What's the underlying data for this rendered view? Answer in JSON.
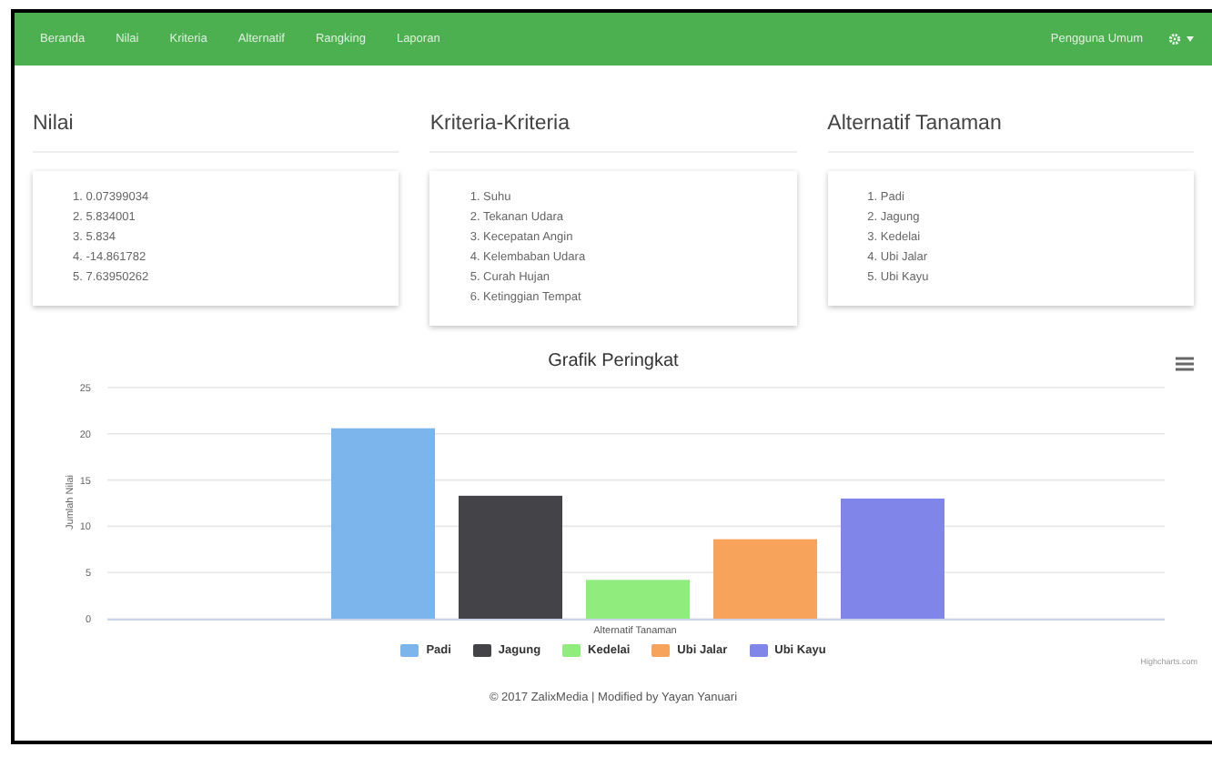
{
  "navbar": {
    "items": [
      "Beranda",
      "Nilai",
      "Kriteria",
      "Alternatif",
      "Rangking",
      "Laporan"
    ],
    "user": "Pengguna Umum"
  },
  "panels": [
    {
      "title": "Nilai",
      "items": [
        "1. 0.07399034",
        "2. 5.834001",
        "3. 5.834",
        "4. -14.861782",
        "5. 7.63950262"
      ]
    },
    {
      "title": "Kriteria-Kriteria",
      "items": [
        "1. Suhu",
        "2. Tekanan Udara",
        "3. Kecepatan Angin",
        "4. Kelembaban Udara",
        "5. Curah Hujan",
        "6. Ketinggian Tempat"
      ]
    },
    {
      "title": "Alternatif Tanaman",
      "items": [
        "1. Padi",
        "2. Jagung",
        "3. Kedelai",
        "4. Ubi Jalar",
        "5. Ubi Kayu"
      ]
    }
  ],
  "chart": {
    "credit": "Highcharts.com",
    "chart_data": {
      "type": "bar",
      "grid": true,
      "title": "Grafik Peringkat",
      "xlabel": "Alternatif Tanaman",
      "ylabel": "Jumlah Nilai",
      "ylim": [
        0,
        25
      ],
      "yticks": [
        0,
        5,
        10,
        15,
        20,
        25
      ],
      "series": [
        {
          "name": "Padi",
          "color": "#7cb5ec",
          "values": [
            20.6
          ]
        },
        {
          "name": "Jagung",
          "color": "#434348",
          "values": [
            13.3
          ]
        },
        {
          "name": "Kedelai",
          "color": "#90ed7d",
          "values": [
            4.2
          ]
        },
        {
          "name": "Ubi Jalar",
          "color": "#f7a35c",
          "values": [
            8.6
          ]
        },
        {
          "name": "Ubi Kayu",
          "color": "#8085e9",
          "values": [
            13.0
          ]
        }
      ]
    }
  },
  "footer": "© 2017 ZalixMedia | Modified by Yayan Yanuari"
}
